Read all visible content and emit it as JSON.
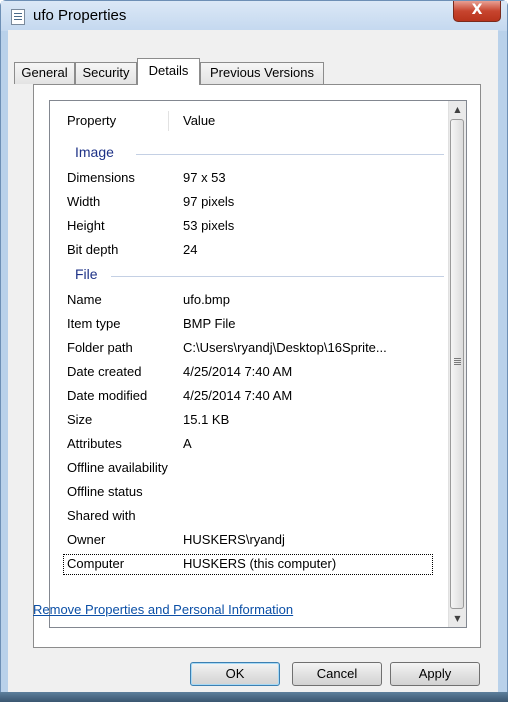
{
  "window": {
    "title": "ufo Properties",
    "close_glyph": "X"
  },
  "tabs": [
    {
      "label": "General"
    },
    {
      "label": "Security"
    },
    {
      "label": "Details"
    },
    {
      "label": "Previous Versions"
    }
  ],
  "details": {
    "header": {
      "property": "Property",
      "value": "Value"
    },
    "groups": {
      "image": "Image",
      "file": "File"
    },
    "image_rows": [
      {
        "property": "Dimensions",
        "value": "97 x 53"
      },
      {
        "property": "Width",
        "value": "97 pixels"
      },
      {
        "property": "Height",
        "value": "53 pixels"
      },
      {
        "property": "Bit depth",
        "value": "24"
      }
    ],
    "file_rows": [
      {
        "property": "Name",
        "value": "ufo.bmp"
      },
      {
        "property": "Item type",
        "value": "BMP File"
      },
      {
        "property": "Folder path",
        "value": "C:\\Users\\ryandj\\Desktop\\16Sprite..."
      },
      {
        "property": "Date created",
        "value": "4/25/2014 7:40 AM"
      },
      {
        "property": "Date modified",
        "value": "4/25/2014 7:40 AM"
      },
      {
        "property": "Size",
        "value": "15.1 KB"
      },
      {
        "property": "Attributes",
        "value": "A"
      },
      {
        "property": "Offline availability",
        "value": ""
      },
      {
        "property": "Offline status",
        "value": ""
      },
      {
        "property": "Shared with",
        "value": ""
      },
      {
        "property": "Owner",
        "value": "HUSKERS\\ryandj"
      },
      {
        "property": "Computer",
        "value": "HUSKERS (this computer)"
      }
    ]
  },
  "remove_link": "Remove Properties and Personal Information",
  "buttons": {
    "ok": "OK",
    "cancel": "Cancel",
    "apply": "Apply"
  },
  "icons": {
    "title": "document-icon",
    "scroll_up": "arrow-up-icon",
    "scroll_down": "arrow-down-icon"
  }
}
